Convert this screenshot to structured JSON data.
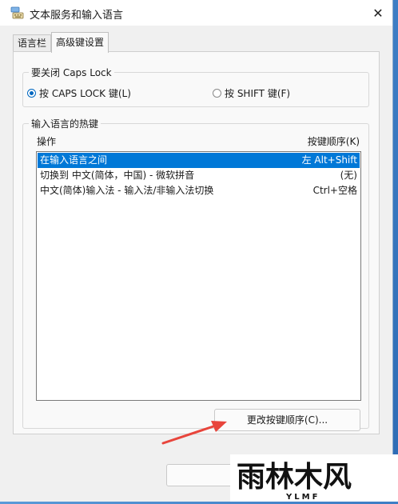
{
  "window": {
    "title": "文本服务和输入语言",
    "close_symbol": "✕"
  },
  "tabs": [
    {
      "label": "语言栏"
    },
    {
      "label": "高级键设置"
    }
  ],
  "caps_lock_group": {
    "label": "要关闭 Caps Lock",
    "options": [
      {
        "label": "按 CAPS LOCK 键(L)",
        "checked": true
      },
      {
        "label": "按 SHIFT 键(F)",
        "checked": false
      }
    ]
  },
  "hotkeys_group": {
    "label": "输入语言的热键",
    "columns": {
      "action": "操作",
      "sequence": "按键顺序(K)"
    },
    "rows": [
      {
        "action": "在输入语言之间",
        "sequence": "左 Alt+Shift",
        "selected": true
      },
      {
        "action": "切换到 中文(简体，中国) - 微软拼音",
        "sequence": "(无)",
        "selected": false
      },
      {
        "action": "中文(简体)输入法 - 输入法/非输入法切换",
        "sequence": "Ctrl+空格",
        "selected": false
      }
    ],
    "change_button": "更改按键顺序(C)..."
  },
  "colors": {
    "accent": "#0078d7",
    "annotation_arrow": "#e8453c"
  },
  "watermark": {
    "text": "雨林木风",
    "subtext": "YLMF"
  }
}
